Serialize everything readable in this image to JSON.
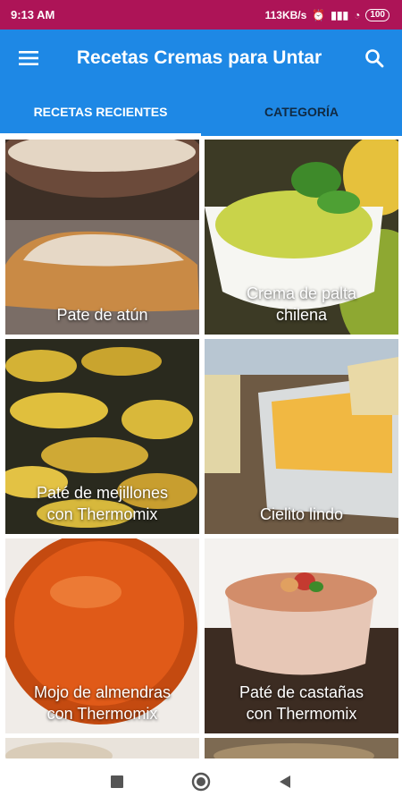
{
  "status": {
    "time": "9:13 AM",
    "speed": "113KB/s",
    "battery": "100"
  },
  "appbar": {
    "title": "Recetas Cremas para Untar",
    "menu_icon": "hamburger-menu-icon",
    "search_icon": "search-icon"
  },
  "tabs": [
    {
      "label": "RECETAS RECIENTES",
      "active": true
    },
    {
      "label": "CATEGORÍA",
      "active": false
    }
  ],
  "recipes": [
    {
      "line1": "Pate de atún",
      "line2": ""
    },
    {
      "line1": "Crema de palta",
      "line2": "chilena"
    },
    {
      "line1": "Paté de mejillones",
      "line2": "con Thermomix"
    },
    {
      "line1": "Cielito lindo",
      "line2": ""
    },
    {
      "line1": "Mojo de almendras",
      "line2": "con Thermomix"
    },
    {
      "line1": "Paté de castañas",
      "line2": "con Thermomix"
    }
  ],
  "colors": {
    "status_bar": "#ad1457",
    "app_bar": "#1e88e5",
    "inactive_tab": "#102a43"
  }
}
